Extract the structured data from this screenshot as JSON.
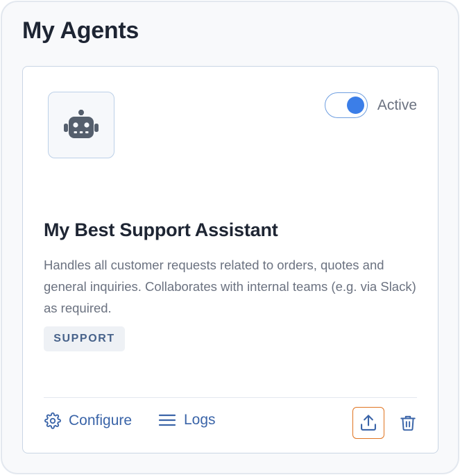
{
  "panel": {
    "title": "My Agents"
  },
  "agent": {
    "status_label": "Active",
    "status_on": true,
    "name": "My Best Support Assistant",
    "description": "Handles all customer requests related to orders, quotes and general inquiries. Collaborates with internal teams (e.g. via Slack) as required.",
    "tag": "SUPPORT",
    "avatar_icon": "robot-icon"
  },
  "actions": {
    "configure_label": "Configure",
    "configure_icon": "gear-icon",
    "logs_label": "Logs",
    "logs_icon": "menu-lines-icon",
    "export_icon": "upload-icon",
    "delete_icon": "trash-icon"
  },
  "colors": {
    "accent": "#3b7ee8",
    "link": "#3a64a8",
    "focus_ring": "#e0731f",
    "title": "#1e2533",
    "muted_text": "#6b7280"
  }
}
